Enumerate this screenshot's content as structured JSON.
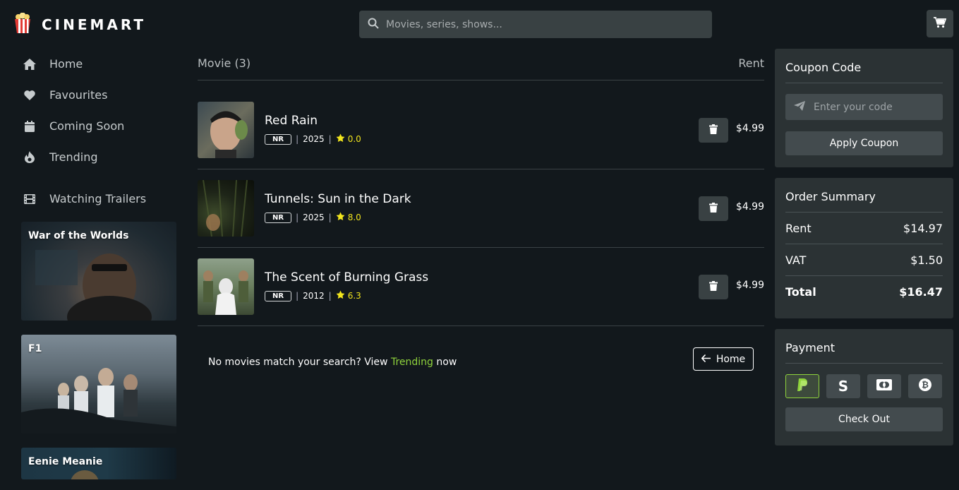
{
  "brand": {
    "name": "CINEMART"
  },
  "search": {
    "placeholder": "Movies, series, shows..."
  },
  "sidebar": {
    "nav": [
      {
        "label": "Home",
        "icon": "home-icon"
      },
      {
        "label": "Favourites",
        "icon": "heart-icon"
      },
      {
        "label": "Coming Soon",
        "icon": "calendar-icon"
      },
      {
        "label": "Trending",
        "icon": "fire-icon"
      }
    ],
    "trailers_label": "Watching Trailers",
    "trailers": [
      {
        "title": "War of the Worlds"
      },
      {
        "title": "F1"
      },
      {
        "title": "Eenie Meanie"
      }
    ]
  },
  "main": {
    "header_left": "Movie (3)",
    "header_right": "Rent",
    "movies": [
      {
        "title": "Red Rain",
        "rating_badge": "NR",
        "year": "2025",
        "score": "0.0",
        "price": "$4.99"
      },
      {
        "title": "Tunnels: Sun in the Dark",
        "rating_badge": "NR",
        "year": "2025",
        "score": "8.0",
        "price": "$4.99"
      },
      {
        "title": "The Scent of Burning Grass",
        "rating_badge": "NR",
        "year": "2012",
        "score": "6.3",
        "price": "$4.99"
      }
    ],
    "no_match_prefix": "No movies match your search? View",
    "no_match_link": "Trending",
    "no_match_suffix": "now",
    "home_button": "Home"
  },
  "coupon": {
    "title": "Coupon Code",
    "placeholder": "Enter your code",
    "apply_label": "Apply Coupon"
  },
  "summary": {
    "title": "Order Summary",
    "rows": [
      {
        "label": "Rent",
        "value": "$14.97"
      },
      {
        "label": "VAT",
        "value": "$1.50"
      },
      {
        "label": "Total",
        "value": "$16.47"
      }
    ]
  },
  "payment": {
    "title": "Payment",
    "methods": [
      "paypal-icon",
      "skrill-icon",
      "mastercard-icon",
      "bitcoin-icon"
    ],
    "selected": "paypal-icon",
    "checkout_label": "Check Out"
  },
  "colors": {
    "accent": "#8fd33c",
    "star": "#f2e51d",
    "background": "#12181c",
    "panel": "#2b3234"
  }
}
